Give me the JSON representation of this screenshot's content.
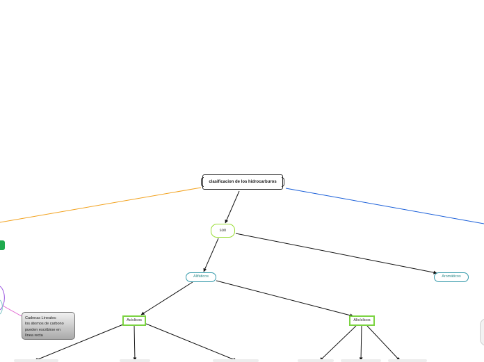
{
  "map": {
    "root": "clasificacion de los hidrocarburos",
    "connector": "son",
    "aliphatic": "Alifáticos",
    "aromatic": "Aromáticos",
    "acyclic": "Acíclicos",
    "alicyclic": "Alicíclicos",
    "note": {
      "lines": [
        "Cadenas Lineales:",
        "los átomos de carbono",
        "pueden escribirse en",
        "línea recta"
      ]
    }
  },
  "colors": {
    "left_branch": "#f2a11c",
    "right_branch": "#1a5fd9",
    "connector_line": "#111111",
    "pink_link": "#e060d0",
    "purple_ring": "#9a55e0",
    "green_tab": "#1faa4e",
    "green_border": "#7bd341",
    "teal_border": "#3399aa"
  }
}
